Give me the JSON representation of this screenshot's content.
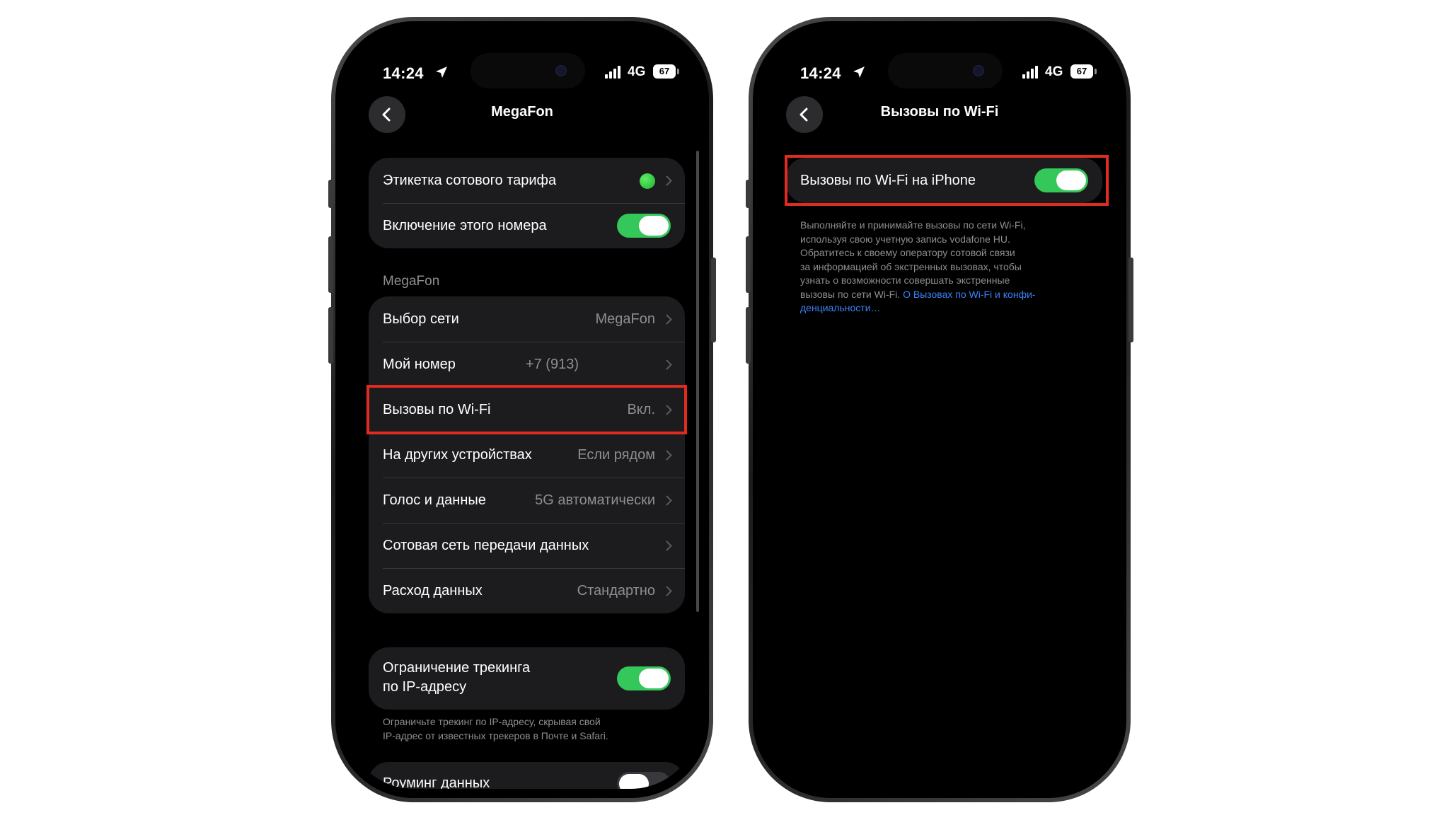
{
  "status_bar": {
    "time": "14:24",
    "network": "4G",
    "battery": "67"
  },
  "left_screen": {
    "title": "MegaFon",
    "group1": [
      {
        "label": "Этикетка сотового тарифа"
      },
      {
        "label": "Включение этого номера",
        "toggle": true
      }
    ],
    "section_header": "MegaFon",
    "group2": [
      {
        "label": "Выбор сети",
        "value": "MegaFon"
      },
      {
        "label": "Мой номер",
        "value": "+7 (913)"
      },
      {
        "label": "Вызовы по Wi-Fi",
        "value": "Вкл."
      },
      {
        "label": "На других устройствах",
        "value": "Если рядом"
      },
      {
        "label": "Голос и данные",
        "value": "5G автоматически"
      },
      {
        "label": "Сотовая сеть передачи данных",
        "value": ""
      },
      {
        "label": "Расход данных",
        "value": "Стандартно"
      }
    ],
    "ip_tracking": {
      "line1": "Ограничение трекинга",
      "line2": "по IP-адресу",
      "toggle": true
    },
    "ip_footnote": {
      "line1": "Ограничьте трекинг по IP-адресу, скрывая свой",
      "line2": "IP-адрес от известных трекеров в Почте и Safari."
    },
    "roaming": {
      "label": "Роуминг данных",
      "toggle": false
    }
  },
  "right_screen": {
    "title": "Вызовы по Wi-Fi",
    "wifi_calls_row": {
      "label": "Вызовы по Wi-Fi на iPhone",
      "toggle": true
    },
    "footnote_lines": [
      "Выполняйте и принимайте вызовы по сети Wi-Fi,",
      "используя свою учетную запись vodafone HU.",
      "Обратитесь к своему оператору сотовой связи",
      "за информацией об экстренных вызовах, чтобы",
      "узнать о возможности совершать экстренные"
    ],
    "footnote_last_text": "вызовы по сети Wi-Fi. ",
    "footnote_link_1": "О Вызовах по Wi-Fi и конфи-",
    "footnote_link_2": "денциальности…"
  },
  "colors": {
    "accent_green": "#34c759",
    "highlight_red": "#e02b20",
    "link_blue": "#3a82f7"
  }
}
